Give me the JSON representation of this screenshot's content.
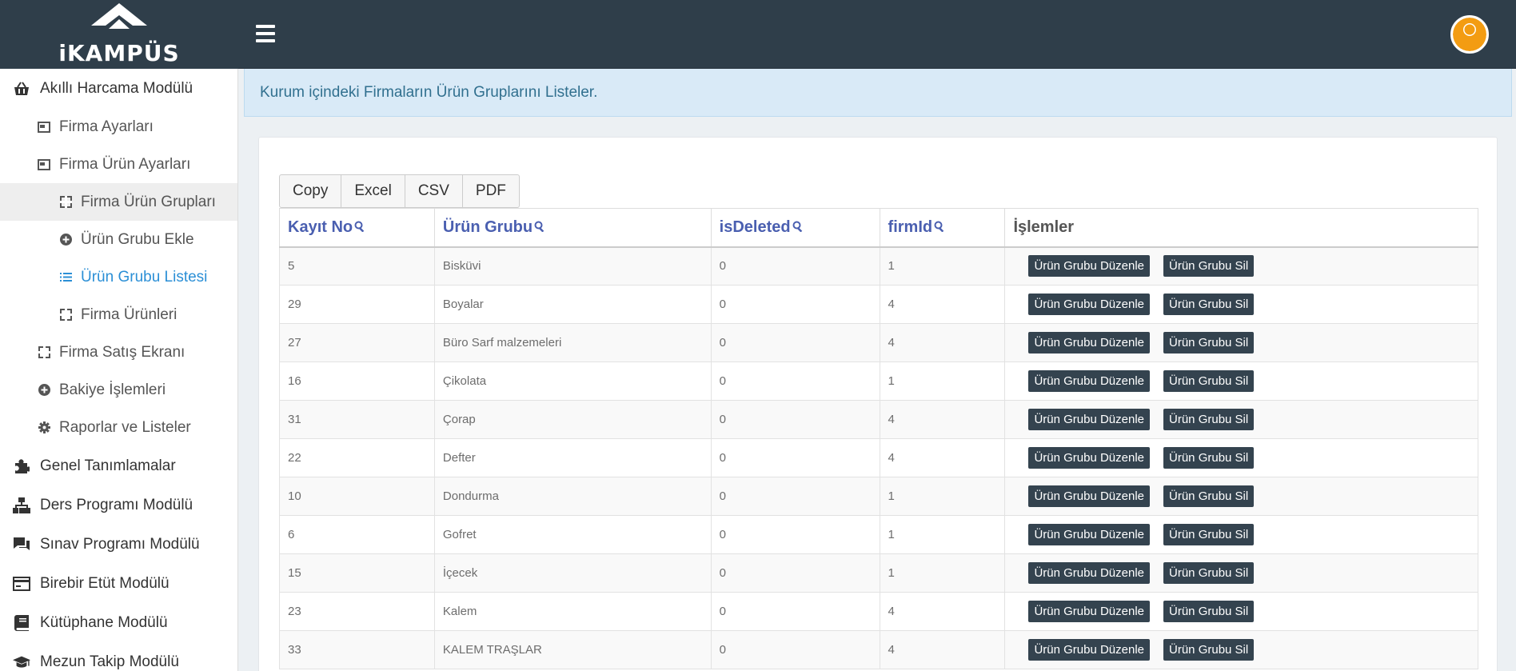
{
  "brand": {
    "logo_text": "iKAMPÜS"
  },
  "sidebar": {
    "items": [
      {
        "label": "Akıllı Harcama Modülü",
        "icon": "basket-icon",
        "level": 0
      },
      {
        "label": "Firma Ayarları",
        "icon": "window-icon",
        "level": 1
      },
      {
        "label": "Firma Ürün Ayarları",
        "icon": "window-icon",
        "level": 1
      },
      {
        "label": "Firma Ürün Grupları",
        "icon": "grid-icon",
        "level": 2
      },
      {
        "label": "Ürün Grubu Ekle",
        "icon": "plus-circle-icon",
        "level": 2
      },
      {
        "label": "Ürün Grubu Listesi",
        "icon": "list-icon",
        "level": 2
      },
      {
        "label": "Firma Ürünleri",
        "icon": "grid-icon",
        "level": 2
      },
      {
        "label": "Firma Satış Ekranı",
        "icon": "grid-icon",
        "level": 1
      },
      {
        "label": "Bakiye İşlemleri",
        "icon": "plus-circle-icon",
        "level": 1
      },
      {
        "label": "Raporlar ve Listeler",
        "icon": "gear-icon",
        "level": 1
      },
      {
        "label": "Genel Tanımlamalar",
        "icon": "puzzle-icon",
        "level": 0
      },
      {
        "label": "Ders Programı Modülü",
        "icon": "sitemap-icon",
        "level": 0
      },
      {
        "label": "Sınav Programı Modülü",
        "icon": "chat-icon",
        "level": 0
      },
      {
        "label": "Birebir Etüt Modülü",
        "icon": "card-icon",
        "level": 0
      },
      {
        "label": "Kütüphane Modülü",
        "icon": "book-icon",
        "level": 0
      },
      {
        "label": "Mezun Takip Modülü",
        "icon": "graduation-cap-icon",
        "level": 0
      }
    ]
  },
  "banner": {
    "text": "Kurum içindeki Firmaların Ürün Gruplarını Listeler."
  },
  "export": {
    "copy": "Copy",
    "excel": "Excel",
    "csv": "CSV",
    "pdf": "PDF"
  },
  "table": {
    "headers": {
      "id": "Kayıt No",
      "group": "Ürün Grubu",
      "deleted": "isDeleted",
      "firm": "firmId",
      "actions": "İşlemler"
    },
    "edit_label": "Ürün Grubu Düzenle",
    "delete_label": "Ürün Grubu Sil",
    "rows": [
      {
        "id": "5",
        "group": "Bisküvi",
        "deleted": "0",
        "firm": "1"
      },
      {
        "id": "29",
        "group": "Boyalar",
        "deleted": "0",
        "firm": "4"
      },
      {
        "id": "27",
        "group": "Büro Sarf malzemeleri",
        "deleted": "0",
        "firm": "4"
      },
      {
        "id": "16",
        "group": "Çikolata",
        "deleted": "0",
        "firm": "1"
      },
      {
        "id": "31",
        "group": "Çorap",
        "deleted": "0",
        "firm": "4"
      },
      {
        "id": "22",
        "group": "Defter",
        "deleted": "0",
        "firm": "4"
      },
      {
        "id": "10",
        "group": "Dondurma",
        "deleted": "0",
        "firm": "1"
      },
      {
        "id": "6",
        "group": "Gofret",
        "deleted": "0",
        "firm": "1"
      },
      {
        "id": "15",
        "group": "İçecek",
        "deleted": "0",
        "firm": "1"
      },
      {
        "id": "23",
        "group": "Kalem",
        "deleted": "0",
        "firm": "4"
      },
      {
        "id": "33",
        "group": "KALEM TRAŞLAR",
        "deleted": "0",
        "firm": "4"
      }
    ]
  },
  "colors": {
    "topbar": "#2f3e4a",
    "accent": "#2b8fd6",
    "header_link": "#4a5fb0",
    "action_button": "#34434f",
    "avatar": "#f39c12"
  }
}
